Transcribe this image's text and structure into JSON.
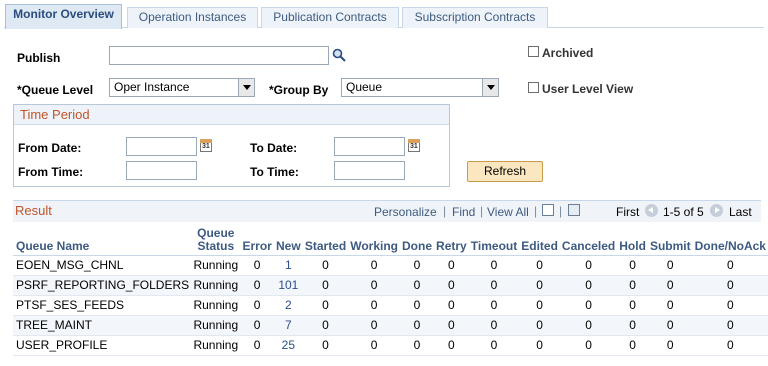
{
  "tabs": [
    {
      "label": "Monitor Overview",
      "active": true
    },
    {
      "label": "Operation Instances",
      "active": false
    },
    {
      "label": "Publication Contracts",
      "active": false
    },
    {
      "label": "Subscription Contracts",
      "active": false
    }
  ],
  "form": {
    "publish_label": "Publish",
    "publish_value": "",
    "queue_level_label": "*Queue Level",
    "queue_level_value": "Oper Instance",
    "group_by_label": "*Group By",
    "group_by_value": "Queue",
    "archived_label": "Archived",
    "archived_checked": false,
    "user_level_view_label": "User Level View",
    "user_level_view_checked": false
  },
  "time_period": {
    "title": "Time Period",
    "from_date_label": "From Date:",
    "to_date_label": "To Date:",
    "from_time_label": "From Time:",
    "to_time_label": "To Time:",
    "from_date": "",
    "to_date": "",
    "from_time": "",
    "to_time": "",
    "calendar_icon_text": "31"
  },
  "refresh_label": "Refresh",
  "grid": {
    "title": "Result",
    "personalize": "Personalize",
    "find": "Find",
    "view_all": "View All",
    "separator": "|",
    "first": "First",
    "range": "1-5 of 5",
    "last": "Last",
    "columns": [
      "Queue Name",
      "Queue Status",
      "Error",
      "New",
      "Started",
      "Working",
      "Done",
      "Retry",
      "Timeout",
      "Edited",
      "Canceled",
      "Hold",
      "Submit",
      "Done/NoAck"
    ],
    "queue_status_line1": "Queue",
    "queue_status_line2": "Status",
    "rows": [
      {
        "queue_name": "EOEN_MSG_CHNL",
        "status": "Running",
        "error": "0",
        "new": "1",
        "started": "0",
        "working": "0",
        "done": "0",
        "retry": "0",
        "timeout": "0",
        "edited": "0",
        "canceled": "0",
        "hold": "0",
        "submit": "0",
        "done_noack": "0"
      },
      {
        "queue_name": "PSRF_REPORTING_FOLDERS",
        "status": "Running",
        "error": "0",
        "new": "101",
        "started": "0",
        "working": "0",
        "done": "0",
        "retry": "0",
        "timeout": "0",
        "edited": "0",
        "canceled": "0",
        "hold": "0",
        "submit": "0",
        "done_noack": "0"
      },
      {
        "queue_name": "PTSF_SES_FEEDS",
        "status": "Running",
        "error": "0",
        "new": "2",
        "started": "0",
        "working": "0",
        "done": "0",
        "retry": "0",
        "timeout": "0",
        "edited": "0",
        "canceled": "0",
        "hold": "0",
        "submit": "0",
        "done_noack": "0"
      },
      {
        "queue_name": "TREE_MAINT",
        "status": "Running",
        "error": "0",
        "new": "7",
        "started": "0",
        "working": "0",
        "done": "0",
        "retry": "0",
        "timeout": "0",
        "edited": "0",
        "canceled": "0",
        "hold": "0",
        "submit": "0",
        "done_noack": "0"
      },
      {
        "queue_name": "USER_PROFILE",
        "status": "Running",
        "error": "0",
        "new": "25",
        "started": "0",
        "working": "0",
        "done": "0",
        "retry": "0",
        "timeout": "0",
        "edited": "0",
        "canceled": "0",
        "hold": "0",
        "submit": "0",
        "done_noack": "0"
      }
    ]
  },
  "colors": {
    "section_title": "#c0542a",
    "link": "#3d5a80",
    "refresh_bg": "#fbe7bf"
  }
}
